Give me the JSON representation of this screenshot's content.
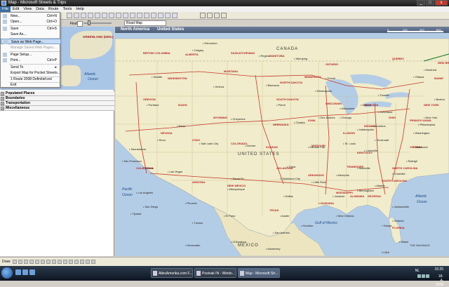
{
  "window": {
    "title": "Map - Microsoft Streets & Trips"
  },
  "menubar": [
    "File",
    "Edit",
    "View",
    "Data",
    "Route",
    "Tools",
    "Help"
  ],
  "file_menu": [
    {
      "label": "New...",
      "shortcut": "Ctrl+N"
    },
    {
      "label": "Open...",
      "shortcut": "Ctrl+O"
    },
    {
      "label": "Save",
      "shortcut": "Ctrl+S"
    },
    {
      "label": "Save As...",
      "shortcut": ""
    },
    {
      "label": "Save as Web Page...",
      "shortcut": "",
      "highlighted": true
    },
    {
      "label": "Manage Saved Web Pages...",
      "shortcut": "",
      "disabled": true
    },
    {
      "label": "Page Setup...",
      "shortcut": ""
    },
    {
      "label": "Print...",
      "shortcut": "Ctrl+P"
    },
    {
      "label": "Send To",
      "shortcut": "▸"
    },
    {
      "label": "Export Map for Pocket Streets...",
      "shortcut": ""
    },
    {
      "label": "1 Route 2008 Definitief.est",
      "shortcut": ""
    },
    {
      "label": "Exit",
      "shortcut": ""
    }
  ],
  "toolbar": {
    "find_label": "Find",
    "map_type": "Road Map"
  },
  "minimap": {
    "greenland": "GREENLAND (DEN.)",
    "atlantic": "Atlantic",
    "ocean": "Ocean"
  },
  "panel_sections": [
    "Populated Places",
    "Boundaries",
    "Transportation",
    "Miscellaneous"
  ],
  "map": {
    "breadcrumb": [
      "North America",
      "United States"
    ],
    "scale": [
      "0",
      "200",
      "400",
      "600"
    ],
    "colors": {
      "water": "#b4cde6",
      "land": "#f1eccb",
      "highway": "#c23a2a",
      "state_label": "#b42525",
      "city_label": "#1a1a1a"
    },
    "states": [
      "WASHINGTON",
      "MONTANA",
      "NORTH DAKOTA",
      "MINNESOTA",
      "OREGON",
      "IDAHO",
      "SOUTH DAKOTA",
      "WYOMING",
      "WISCONSIN",
      "MICHIGAN",
      "NEBRASKA",
      "IOWA",
      "NEVADA",
      "UTAH",
      "COLORADO",
      "KANSAS",
      "MISSOURI",
      "ILLINOIS",
      "INDIANA",
      "OHIO",
      "CALIFORNIA",
      "ARIZONA",
      "NEW MEXICO",
      "OKLAHOMA",
      "ARKANSAS",
      "TENNESSEE",
      "KENTUCKY",
      "TEXAS",
      "LOUISIANA",
      "MISSISSIPPI",
      "ALABAMA",
      "GEORGIA",
      "FLORIDA",
      "SOUTH CAROLINA",
      "NORTH CAROLINA",
      "VIRGINIA",
      "PENNSYLVANIA",
      "NEW YORK",
      "MAINE",
      "ALBERTA",
      "SASKATCHEWAN",
      "MANITOBA",
      "ONTARIO",
      "QUEBEC",
      "BRITISH COLUMBIA",
      "NEW BRUNSWICK"
    ],
    "cities": [
      "Seattle",
      "Portland",
      "Boise",
      "Helena",
      "Calgary",
      "Edmonton",
      "Regina",
      "Winnipeg",
      "Bismarck",
      "Pierre",
      "Minneapolis",
      "Duluth",
      "Chicago",
      "Detroit",
      "Toronto",
      "Ottawa",
      "Montreal",
      "Boston",
      "New York",
      "Philadelphia",
      "Washington",
      "Richmond",
      "Cleveland",
      "Columbus",
      "Indianapolis",
      "St. Louis",
      "Kansas City",
      "Omaha",
      "Des Moines",
      "Denver",
      "Salt Lake City",
      "Cheyenne",
      "Reno",
      "Sacramento",
      "San Francisco",
      "Fresno",
      "Los Angeles",
      "San Diego",
      "Las Vegas",
      "Phoenix",
      "Tucson",
      "Albuquerque",
      "Santa Fe",
      "El Paso",
      "Dallas",
      "Houston",
      "San Antonio",
      "Austin",
      "Oklahoma City",
      "Tulsa",
      "Little Rock",
      "Memphis",
      "Nashville",
      "Atlanta",
      "Birmingham",
      "Jackson",
      "New Orleans",
      "Jacksonville",
      "Orlando",
      "Tampa",
      "Miami",
      "Charlotte",
      "Raleigh",
      "Louisville",
      "Cincinnati",
      "Milwaukee",
      "Monterrey",
      "Chihuahua",
      "Hermosillo",
      "Tijuana"
    ],
    "labels": {
      "country_us": "UNITED STATES",
      "country_ca": "CANADA",
      "country_mx": "MEXICO",
      "pacific": "Pacific",
      "pacific2": "Ocean",
      "atlantic": "Atlantic",
      "atlantic2": "Ocean",
      "gulf": "Gulf of Mexico",
      "bahamas": "THE BAHAMAS",
      "cuba": "CUBA"
    }
  },
  "bottom_toolbar": {
    "label": "Draw"
  },
  "taskbar": {
    "tasks": [
      {
        "label": "AllesAmerika.com F...",
        "active": false
      },
      {
        "label": "Postvak IN - Windo...",
        "active": false
      },
      {
        "label": "Map - Microsoft Str...",
        "active": true
      }
    ],
    "lang": "NL",
    "time": "15:25",
    "day": "vrijdag",
    "date": "18-4-2008"
  }
}
